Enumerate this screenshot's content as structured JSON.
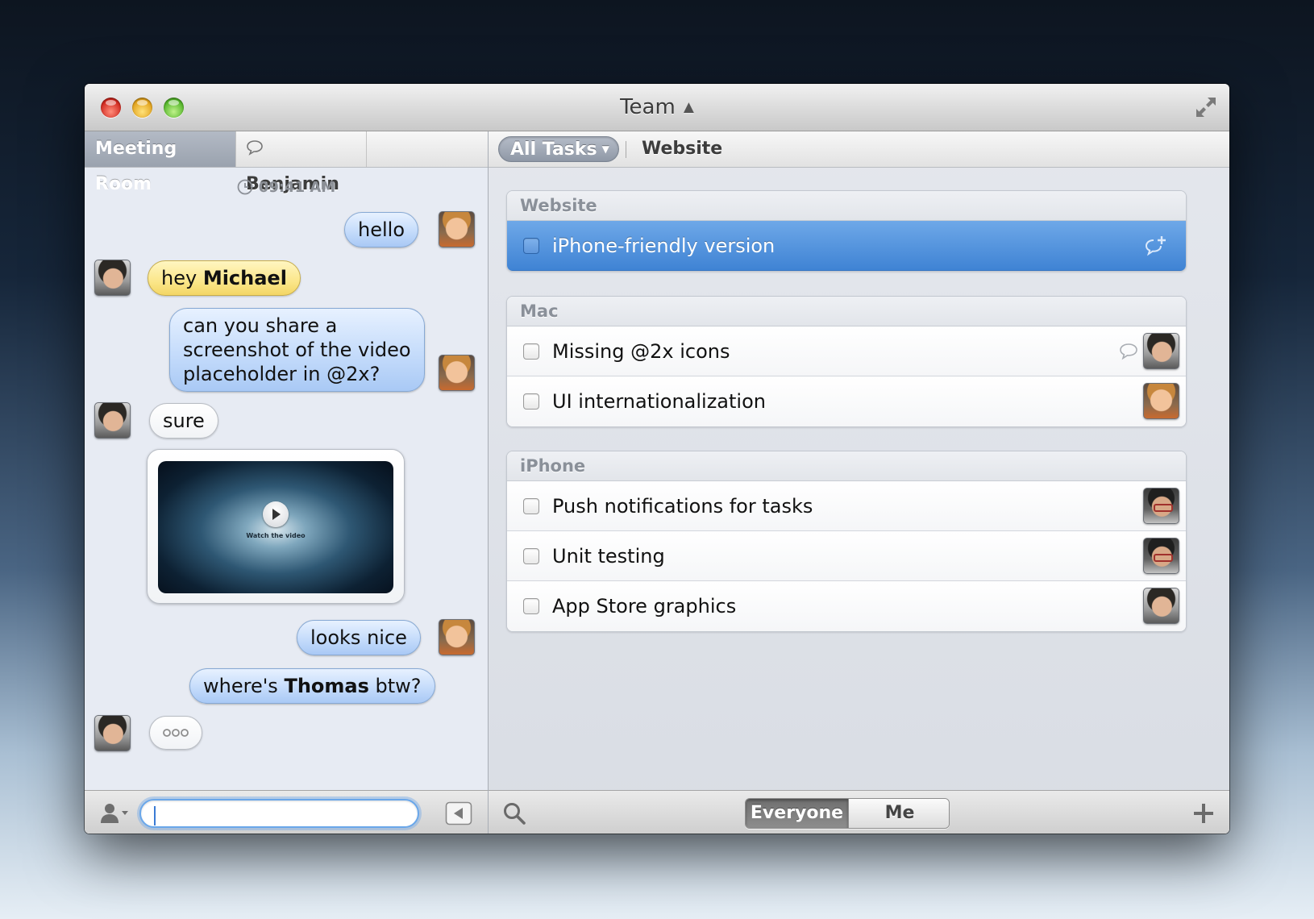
{
  "window": {
    "title": "Team"
  },
  "chat": {
    "tabs": {
      "active": "Meeting Room",
      "secondary": "Benjamin"
    },
    "timestamp": "09:41 AM",
    "messages": [
      {
        "from": "me",
        "text": "hello"
      },
      {
        "from": "other",
        "prefix": "hey ",
        "bold": "Michael",
        "highlight": true
      },
      {
        "from": "me",
        "lines": [
          "can you share a",
          "screenshot of the video",
          "placeholder in @2x?"
        ]
      },
      {
        "from": "other",
        "text": "sure"
      },
      {
        "from": "other",
        "type": "video",
        "caption": "Watch the video"
      },
      {
        "from": "me",
        "text": "looks nice"
      },
      {
        "from": "me",
        "prefix": "where's ",
        "bold": "Thomas",
        "suffix": " btw?"
      },
      {
        "from": "other",
        "typing": true
      }
    ],
    "input": {
      "value": "",
      "placeholder": ""
    }
  },
  "tasks": {
    "filter": "All Tasks",
    "breadcrumb": "Website",
    "groups": [
      {
        "name": "Website",
        "items": [
          {
            "label": "iPhone-friendly version",
            "selected": true,
            "icon": "add-comment-icon"
          }
        ]
      },
      {
        "name": "Mac",
        "items": [
          {
            "label": "Missing @2x icons",
            "assignee": "dark-hair",
            "has_comment": true
          },
          {
            "label": "UI internationalization",
            "assignee": "light-hair"
          }
        ]
      },
      {
        "name": "iPhone",
        "items": [
          {
            "label": "Push notifications for tasks",
            "assignee": "glasses"
          },
          {
            "label": "Unit testing",
            "assignee": "glasses"
          },
          {
            "label": "App Store graphics",
            "assignee": "dark-hair"
          }
        ]
      }
    ],
    "scope": {
      "options": [
        "Everyone",
        "Me"
      ],
      "selected": "Everyone"
    }
  },
  "colors": {
    "accent": "#3f83d4",
    "bubble_out": "#c5dcfb",
    "bubble_highlight": "#fbe68a"
  }
}
